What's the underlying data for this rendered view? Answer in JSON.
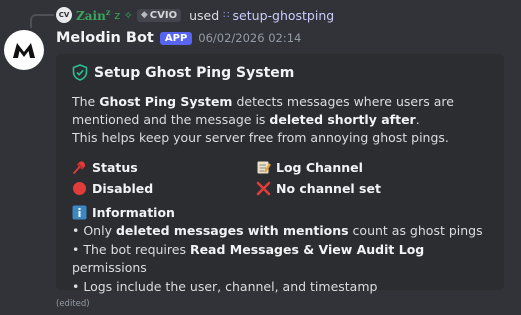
{
  "reply": {
    "avatar_text": "CV",
    "user": "Zain",
    "user_sup": "z",
    "user_extra": "z ✧",
    "tag": "CVIO",
    "used": "used",
    "command": "setup-ghostping"
  },
  "message": {
    "author": "Melodin Bot",
    "badge": "APP",
    "timestamp": "06/02/2026 02:14",
    "edited": "(edited)"
  },
  "embed": {
    "title": "Setup Ghost Ping System",
    "desc_1": "The ",
    "desc_bold_1": "Ghost Ping System",
    "desc_2": " detects messages where users are mentioned and the message is ",
    "desc_bold_2": "deleted shortly after",
    "desc_3": ".",
    "desc_line2": "This helps keep your server free from annoying ghost pings.",
    "fields": [
      {
        "name": "Status",
        "name_icon": "pushpin-icon",
        "value": "Disabled",
        "value_icon": "red-circle-icon"
      },
      {
        "name": "Log Channel",
        "name_icon": "memo-icon",
        "value": "No channel set",
        "value_icon": "red-x-icon"
      }
    ],
    "info_title": "Information",
    "info": [
      {
        "pre": "• Only ",
        "bold": "deleted messages with mentions",
        "post": " count as ghost pings"
      },
      {
        "pre": "• The bot requires ",
        "bold": "Read Messages & View Audit Log",
        "post": " permissions"
      },
      {
        "pre": "• Logs include the user, channel, and timestamp",
        "bold": "",
        "post": ""
      }
    ]
  },
  "colors": {
    "background": "#323339",
    "embed_bg": "#2b2d31",
    "app_badge": "#5865f2",
    "reply_user": "#3ba55d",
    "status_red": "#e03c3c"
  }
}
